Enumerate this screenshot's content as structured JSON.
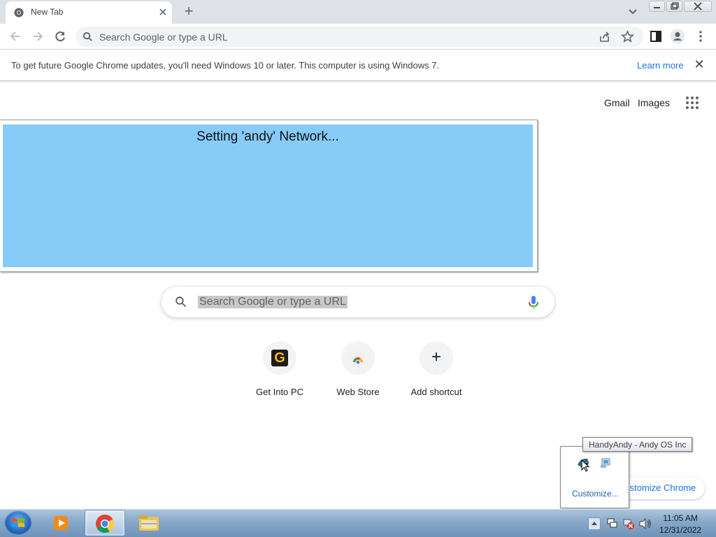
{
  "browser": {
    "tab_title": "New Tab",
    "tab_close": "✕",
    "new_tab": "+",
    "omnibox_placeholder": "Search Google or type a URL"
  },
  "infobar": {
    "message": "To get future Google Chrome updates, you'll need Windows 10 or later. This computer is using Windows 7.",
    "learn_more": "Learn more",
    "close": "✕"
  },
  "ntp": {
    "gmail": "Gmail",
    "images": "Images",
    "search_placeholder": "Search Google or type a URL",
    "shortcuts": [
      {
        "label": "Get Into PC",
        "icon": "G"
      },
      {
        "label": "Web Store"
      },
      {
        "label": "Add shortcut",
        "icon": "+"
      }
    ],
    "customize_chrome": "Customize Chrome"
  },
  "andy_popup": {
    "message": "Setting 'andy' Network..."
  },
  "tray_popup": {
    "customize": "Customize...",
    "tooltip": "HandyAndy - Andy OS Inc"
  },
  "taskbar": {
    "time": "11:05 AM",
    "date": "12/31/2022"
  },
  "colors": {
    "andy_panel": "#87cbf8",
    "link_blue": "#1a73e8",
    "tab_strip": "#dee1e6"
  }
}
